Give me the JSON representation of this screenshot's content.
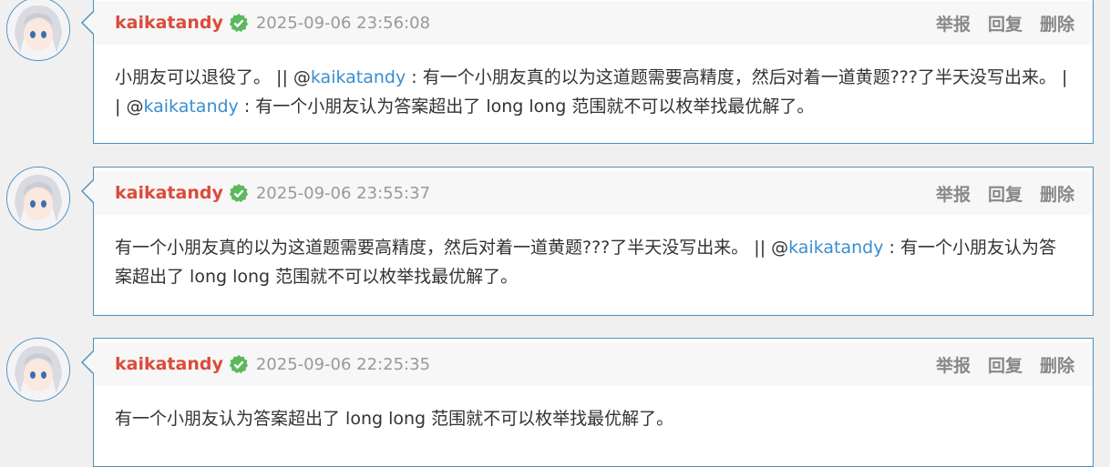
{
  "comments": [
    {
      "username": "kaikatandy",
      "time": "2025-09-06 23:56:08",
      "actions": {
        "report": "举报",
        "reply": "回复",
        "delete": "删除"
      },
      "content": [
        {
          "t": "text",
          "v": "小朋友可以退役了。 || @"
        },
        {
          "t": "mention",
          "v": "kaikatandy"
        },
        {
          "t": "text",
          "v": " : 有一个小朋友真的以为这道题需要高精度，然后对着一道黄题???了半天没写出来。 || @"
        },
        {
          "t": "mention",
          "v": "kaikatandy"
        },
        {
          "t": "text",
          "v": " : 有一个小朋友认为答案超出了 long long 范围就不可以枚举找最优解了。"
        }
      ]
    },
    {
      "username": "kaikatandy",
      "time": "2025-09-06 23:55:37",
      "actions": {
        "report": "举报",
        "reply": "回复",
        "delete": "删除"
      },
      "content": [
        {
          "t": "text",
          "v": "有一个小朋友真的以为这道题需要高精度，然后对着一道黄题???了半天没写出来。 || @"
        },
        {
          "t": "mention",
          "v": "kaikatandy"
        },
        {
          "t": "text",
          "v": " : 有一个小朋友认为答案超出了 long long 范围就不可以枚举找最优解了。"
        }
      ]
    },
    {
      "username": "kaikatandy",
      "time": "2025-09-06 22:25:35",
      "actions": {
        "report": "举报",
        "reply": "回复",
        "delete": "删除"
      },
      "content": [
        {
          "t": "text",
          "v": "有一个小朋友认为答案超出了 long long 范围就不可以枚举找最优解了。"
        }
      ]
    }
  ],
  "colors": {
    "username": "#db4b3b",
    "mention": "#3a8ecf",
    "border": "#4a90c2",
    "verified": "#5cb85c"
  },
  "icons": {
    "verified": "verified-check-icon",
    "avatar": "anime-avatar"
  }
}
